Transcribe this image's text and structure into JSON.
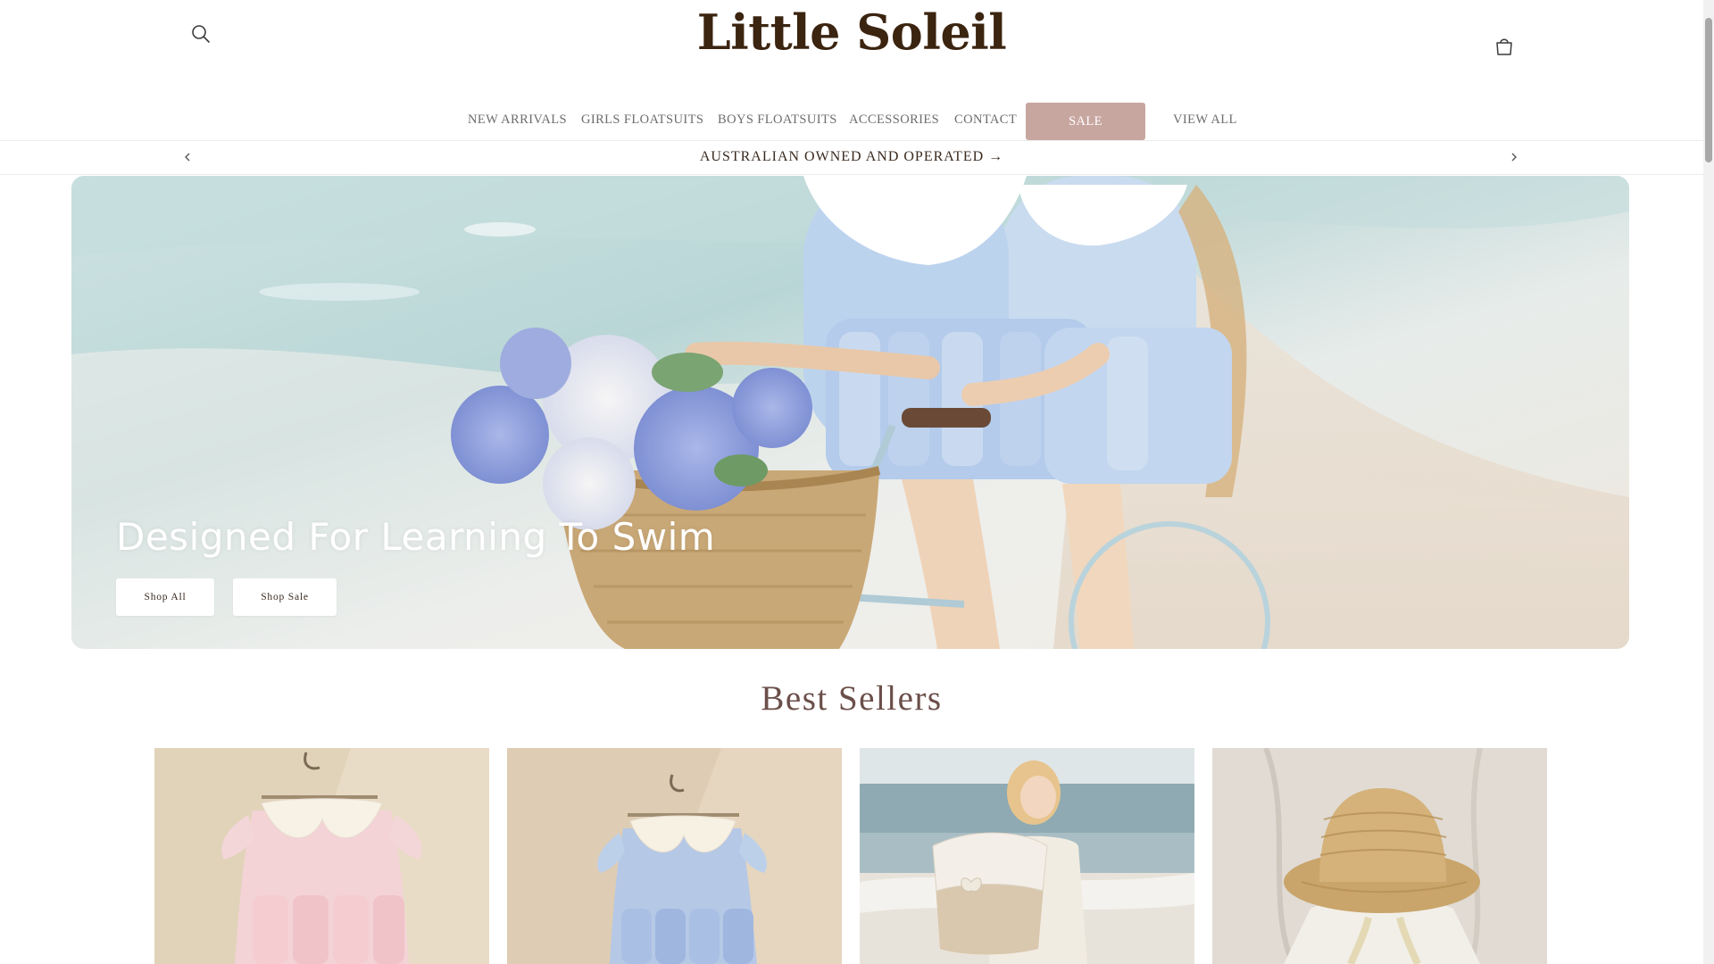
{
  "header": {
    "logo": "Little Soleil",
    "search_icon": "search-icon",
    "cart_icon": "cart-icon"
  },
  "nav": {
    "items": [
      {
        "label": "NEW ARRIVALS"
      },
      {
        "label": "GIRLS FLOATSUITS"
      },
      {
        "label": "BOYS FLOATSUITS"
      },
      {
        "label": "ACCESSORIES"
      },
      {
        "label": "CONTACT"
      },
      {
        "label": "SALE"
      },
      {
        "label": "VIEW ALL"
      }
    ],
    "sale_color": "#c8a6a0"
  },
  "announcement": {
    "text": "AUSTRALIAN OWNED AND OPERATED →",
    "prev_icon": "chevron-left-icon",
    "next_icon": "chevron-right-icon"
  },
  "hero": {
    "heading": "Designed For Learning To Swim",
    "buttons": [
      {
        "label": "Shop All"
      },
      {
        "label": "Shop Sale"
      }
    ]
  },
  "best_sellers": {
    "title": "Best Sellers",
    "products": [
      {
        "image": "pink-floral-floatsuit"
      },
      {
        "image": "blue-floral-floatsuit"
      },
      {
        "image": "girl-with-quilted-backpack"
      },
      {
        "image": "straw-sun-hat"
      }
    ]
  },
  "colors": {
    "brand_text": "#3b2410",
    "section_title": "#6b4f4a",
    "sale_bg": "#c8a6a0"
  }
}
